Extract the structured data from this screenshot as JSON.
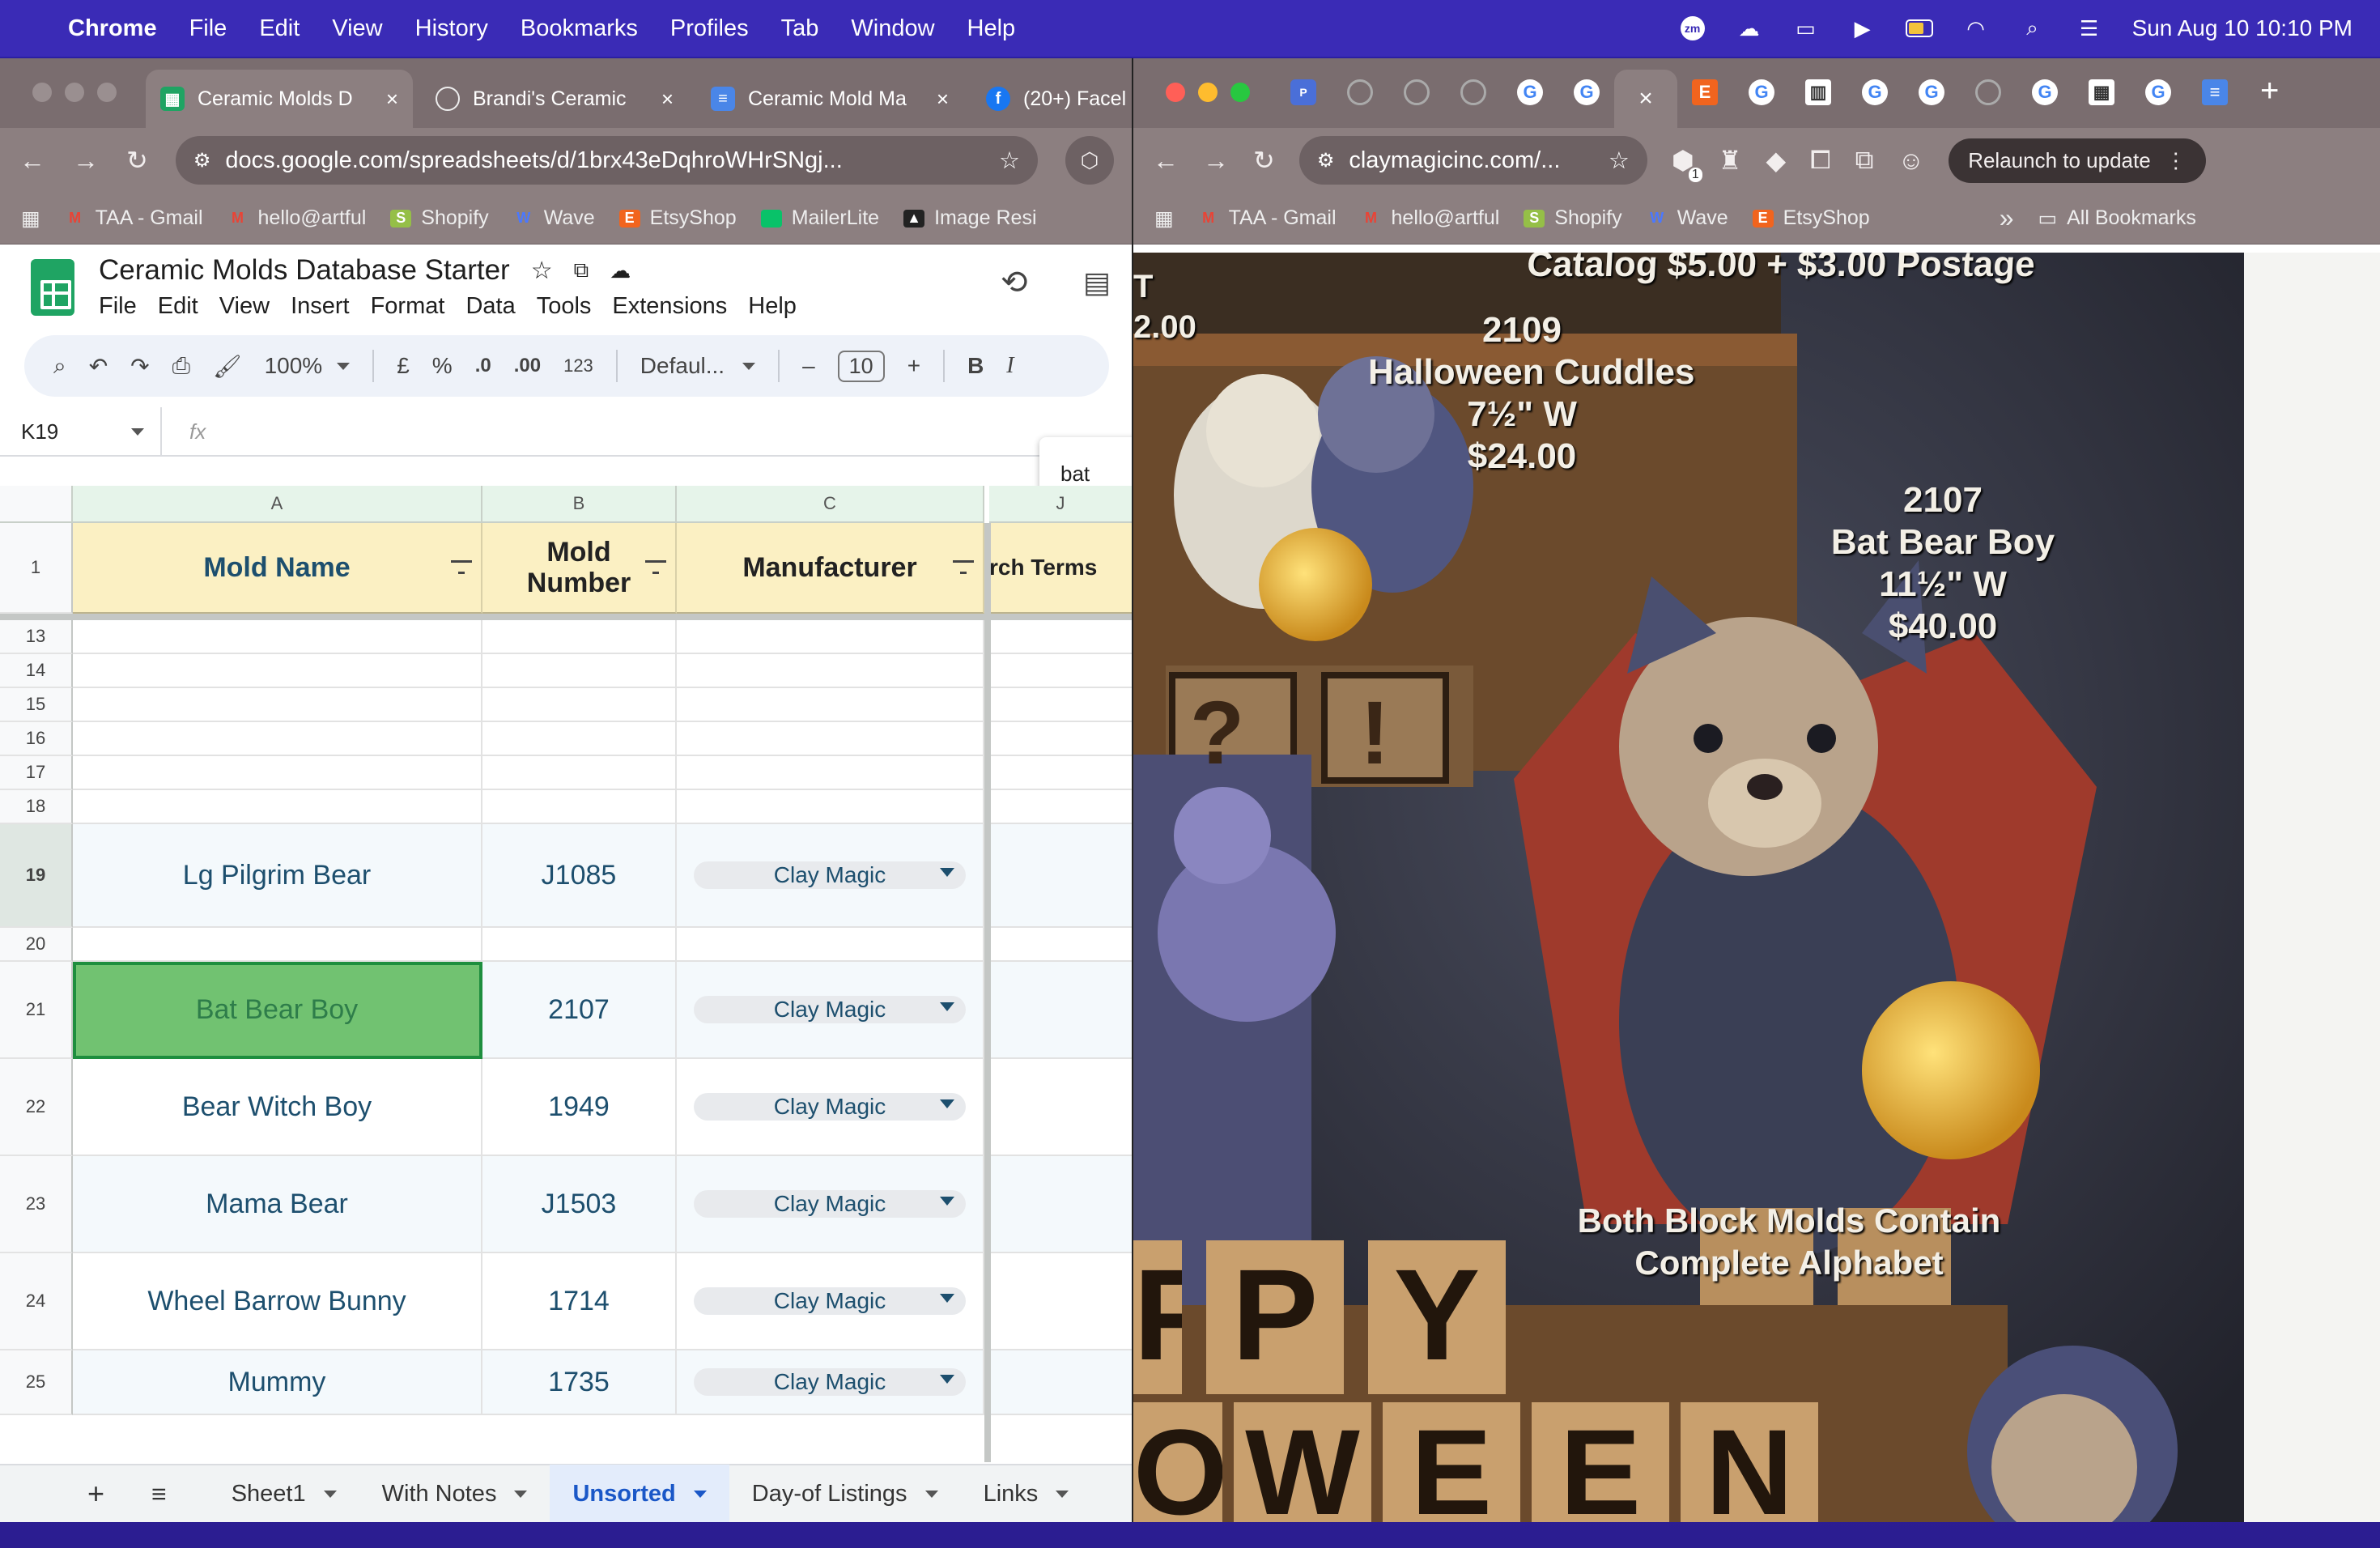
{
  "menubar": {
    "app": "Chrome",
    "items": [
      "File",
      "Edit",
      "View",
      "History",
      "Bookmarks",
      "Profiles",
      "Tab",
      "Window",
      "Help"
    ],
    "clock": "Sun Aug 10  10:10 PM",
    "zoom_badge": "zm"
  },
  "left_browser": {
    "tabs": [
      {
        "title": "Ceramic Molds D",
        "close": "×"
      },
      {
        "title": "Brandi's Ceramic",
        "close": "×"
      },
      {
        "title": "Ceramic Mold Ma",
        "close": "×"
      },
      {
        "title": "(20+) Facel"
      }
    ],
    "url": "docs.google.com/spreadsheets/d/1brx43eDqhroWHrSNgj...",
    "bookmarks": [
      "TAA - Gmail",
      "hello@artful",
      "Shopify",
      "Wave",
      "EtsyShop",
      "MailerLite",
      "Image Resi"
    ]
  },
  "sheet": {
    "title": "Ceramic Molds Database Starter",
    "menu": [
      "File",
      "Edit",
      "View",
      "Insert",
      "Format",
      "Data",
      "Tools",
      "Extensions",
      "Help"
    ],
    "toolbar": {
      "zoom": "100%",
      "currency": "£",
      "percent": "%",
      "dec_less": ".0",
      "dec_more": ".00",
      "number_fmt": "123",
      "font": "Defaul...",
      "font_size": "10",
      "bold": "B",
      "italic": "I"
    },
    "name_box": "K19",
    "fx": "fx",
    "find_text": "bat",
    "columns": [
      "A",
      "B",
      "C",
      "J"
    ],
    "headers": {
      "a": "Mold Name",
      "b": "Mold\nNumber",
      "c": "Manufacturer",
      "j": "rch Terms",
      "row": "1"
    },
    "empty_rows": [
      "13",
      "14",
      "15",
      "16",
      "17",
      "18"
    ],
    "rows": [
      {
        "num": "19",
        "name": "Lg Pilgrim Bear",
        "number": "J1085",
        "mfr": "Clay Magic"
      },
      {
        "num": "20",
        "name": "",
        "number": "",
        "mfr": ""
      },
      {
        "num": "21",
        "name": "Bat Bear Boy",
        "number": "2107",
        "mfr": "Clay Magic"
      },
      {
        "num": "22",
        "name": "Bear Witch Boy",
        "number": "1949",
        "mfr": "Clay Magic"
      },
      {
        "num": "23",
        "name": "Mama Bear",
        "number": "J1503",
        "mfr": "Clay Magic"
      },
      {
        "num": "24",
        "name": "Wheel Barrow Bunny",
        "number": "1714",
        "mfr": "Clay Magic"
      },
      {
        "num": "25",
        "name": "Mummy",
        "number": "1735",
        "mfr": "Clay Magic"
      }
    ],
    "sheet_tabs": [
      "Sheet1",
      "With Notes",
      "Unsorted",
      "Day-of Listings",
      "Links"
    ],
    "active_tab": "Unsorted"
  },
  "right_browser": {
    "url": "claymagicinc.com/...",
    "relaunch": "Relaunch to update",
    "ext_badge": "1",
    "bookmarks": [
      "TAA - Gmail",
      "hello@artful",
      "Shopify",
      "Wave",
      "EtsyShop"
    ],
    "all_bookmarks": "All Bookmarks",
    "more": "»"
  },
  "catalog": {
    "top_text": "Catalog $5.00 + $3.00 Postage",
    "left_top": "2.00",
    "left_small": "T",
    "item1": {
      "number": "2109",
      "name": "Halloween Cuddles",
      "size": "7½\" W",
      "price": "$24.00"
    },
    "item2": {
      "number": "2107",
      "name": "Bat Bear Boy",
      "size": "11½\" W",
      "price": "$40.00"
    },
    "note": "Both Block Molds Contain\nComplete Alphabet",
    "blocks_top": [
      "P",
      "P",
      "Y"
    ],
    "blocks_bottom": [
      "O",
      "W",
      "E",
      "E",
      "N"
    ],
    "marks": [
      "?",
      "!"
    ]
  }
}
